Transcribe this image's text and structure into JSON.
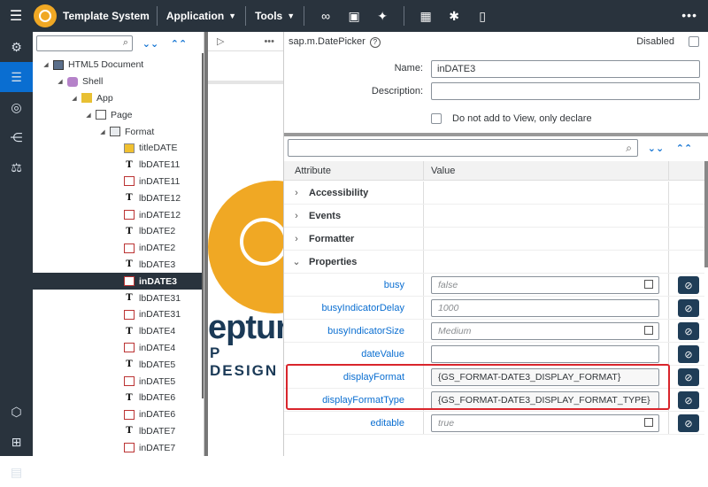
{
  "topbar": {
    "title": "Template System",
    "menu_application": "Application",
    "menu_tools": "Tools",
    "more": "•••"
  },
  "tree": {
    "items": [
      {
        "label": "HTML5 Document"
      },
      {
        "label": "Shell"
      },
      {
        "label": "App"
      },
      {
        "label": "Page"
      },
      {
        "label": "Format"
      },
      {
        "label": "titleDATE"
      },
      {
        "label": "lbDATE11"
      },
      {
        "label": "inDATE11"
      },
      {
        "label": "lbDATE12"
      },
      {
        "label": "inDATE12"
      },
      {
        "label": "lbDATE2"
      },
      {
        "label": "inDATE2"
      },
      {
        "label": "lbDATE3"
      },
      {
        "label": "inDATE3"
      },
      {
        "label": "lbDATE31"
      },
      {
        "label": "inDATE31"
      },
      {
        "label": "lbDATE4"
      },
      {
        "label": "inDATE4"
      },
      {
        "label": "lbDATE5"
      },
      {
        "label": "inDATE5"
      },
      {
        "label": "lbDATE6"
      },
      {
        "label": "inDATE6"
      },
      {
        "label": "lbDATE7"
      },
      {
        "label": "inDATE7"
      }
    ]
  },
  "preview": {
    "more": "•••",
    "brand_line1": "eptur",
    "brand_line2": "P DESIGN"
  },
  "details": {
    "control_type": "sap.m.DatePicker",
    "disabled_label": "Disabled",
    "name_label": "Name:",
    "name_value": "inDATE3",
    "description_label": "Description:",
    "description_value": "",
    "declare_label": "Do not add to View, only declare"
  },
  "props": {
    "col_attribute": "Attribute",
    "col_value": "Value",
    "groups": {
      "accessibility": "Accessibility",
      "events": "Events",
      "formatter": "Formatter",
      "properties": "Properties"
    },
    "rows": [
      {
        "label": "busy",
        "value": "false"
      },
      {
        "label": "busyIndicatorDelay",
        "value": "1000"
      },
      {
        "label": "busyIndicatorSize",
        "value": "Medium"
      },
      {
        "label": "dateValue",
        "value": ""
      },
      {
        "label": "displayFormat",
        "value": "{GS_FORMAT-DATE3_DISPLAY_FORMAT}"
      },
      {
        "label": "displayFormatType",
        "value": "{GS_FORMAT-DATE3_DISPLAY_FORMAT_TYPE}"
      },
      {
        "label": "editable",
        "value": "true"
      }
    ]
  },
  "colors": {
    "shell_dark": "#29333d",
    "accent": "#0a6ed1",
    "brand_orange": "#f0a824",
    "highlight_red": "#d9252c"
  }
}
